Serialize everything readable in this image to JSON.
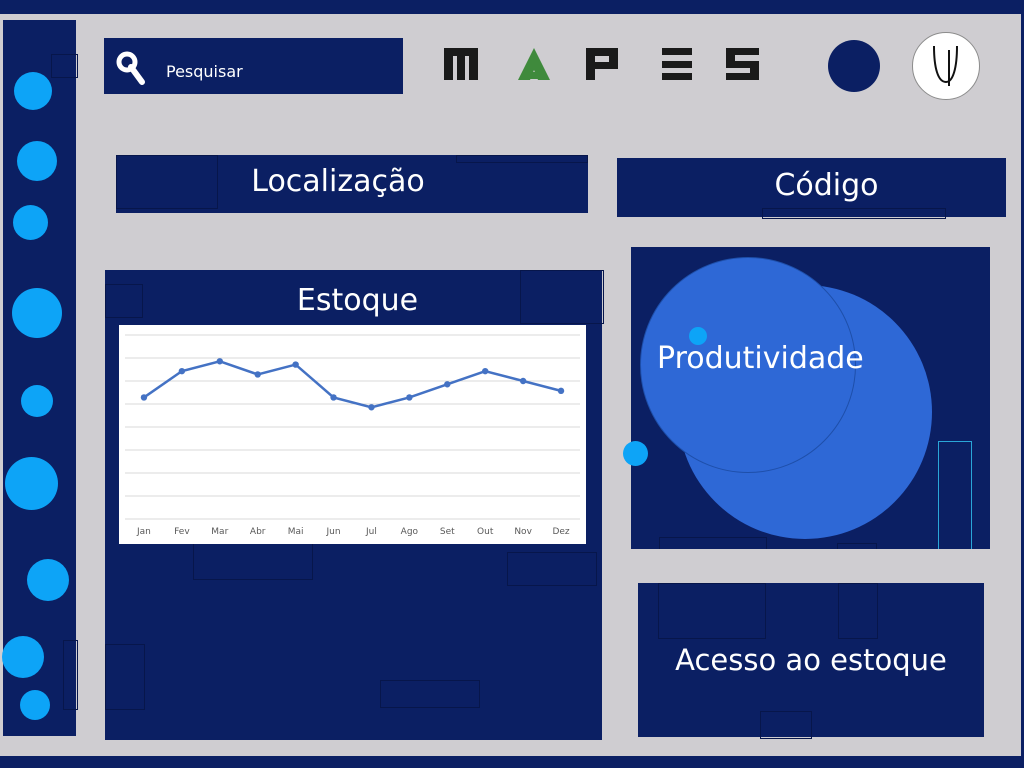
{
  "header": {
    "search": {
      "label": "Pesquisar",
      "icon": "search-icon"
    },
    "logo": {
      "text": "MAPES",
      "letter_colors": [
        "#1a1a1a",
        "#3f8a3c",
        "#1a1a1a",
        "#1a1a1a",
        "#1a1a1a"
      ]
    },
    "avatar_letter": "U"
  },
  "cards": {
    "location": "Localização",
    "code": "Código",
    "stock": "Estoque",
    "productivity": "Produtividade",
    "stock_access": "Acesso ao estoque"
  },
  "colors": {
    "navy": "#0b1f63",
    "frame": "#cfcdd1",
    "accent_dot": "#0da4f7",
    "bubble": "#2e68d6",
    "line": "#4472c4"
  },
  "chart_data": {
    "type": "line",
    "categories": [
      "Jan",
      "Fev",
      "Mar",
      "Abr",
      "Mai",
      "Jun",
      "Jul",
      "Ago",
      "Set",
      "Out",
      "Nov",
      "Dez"
    ],
    "series": [
      {
        "values": [
          6.3,
          7.1,
          7.4,
          7.0,
          7.3,
          6.3,
          6.0,
          6.3,
          6.7,
          7.1,
          6.8,
          6.5
        ]
      }
    ],
    "grid": true,
    "ylim": [
      2.6,
      8.2
    ]
  }
}
